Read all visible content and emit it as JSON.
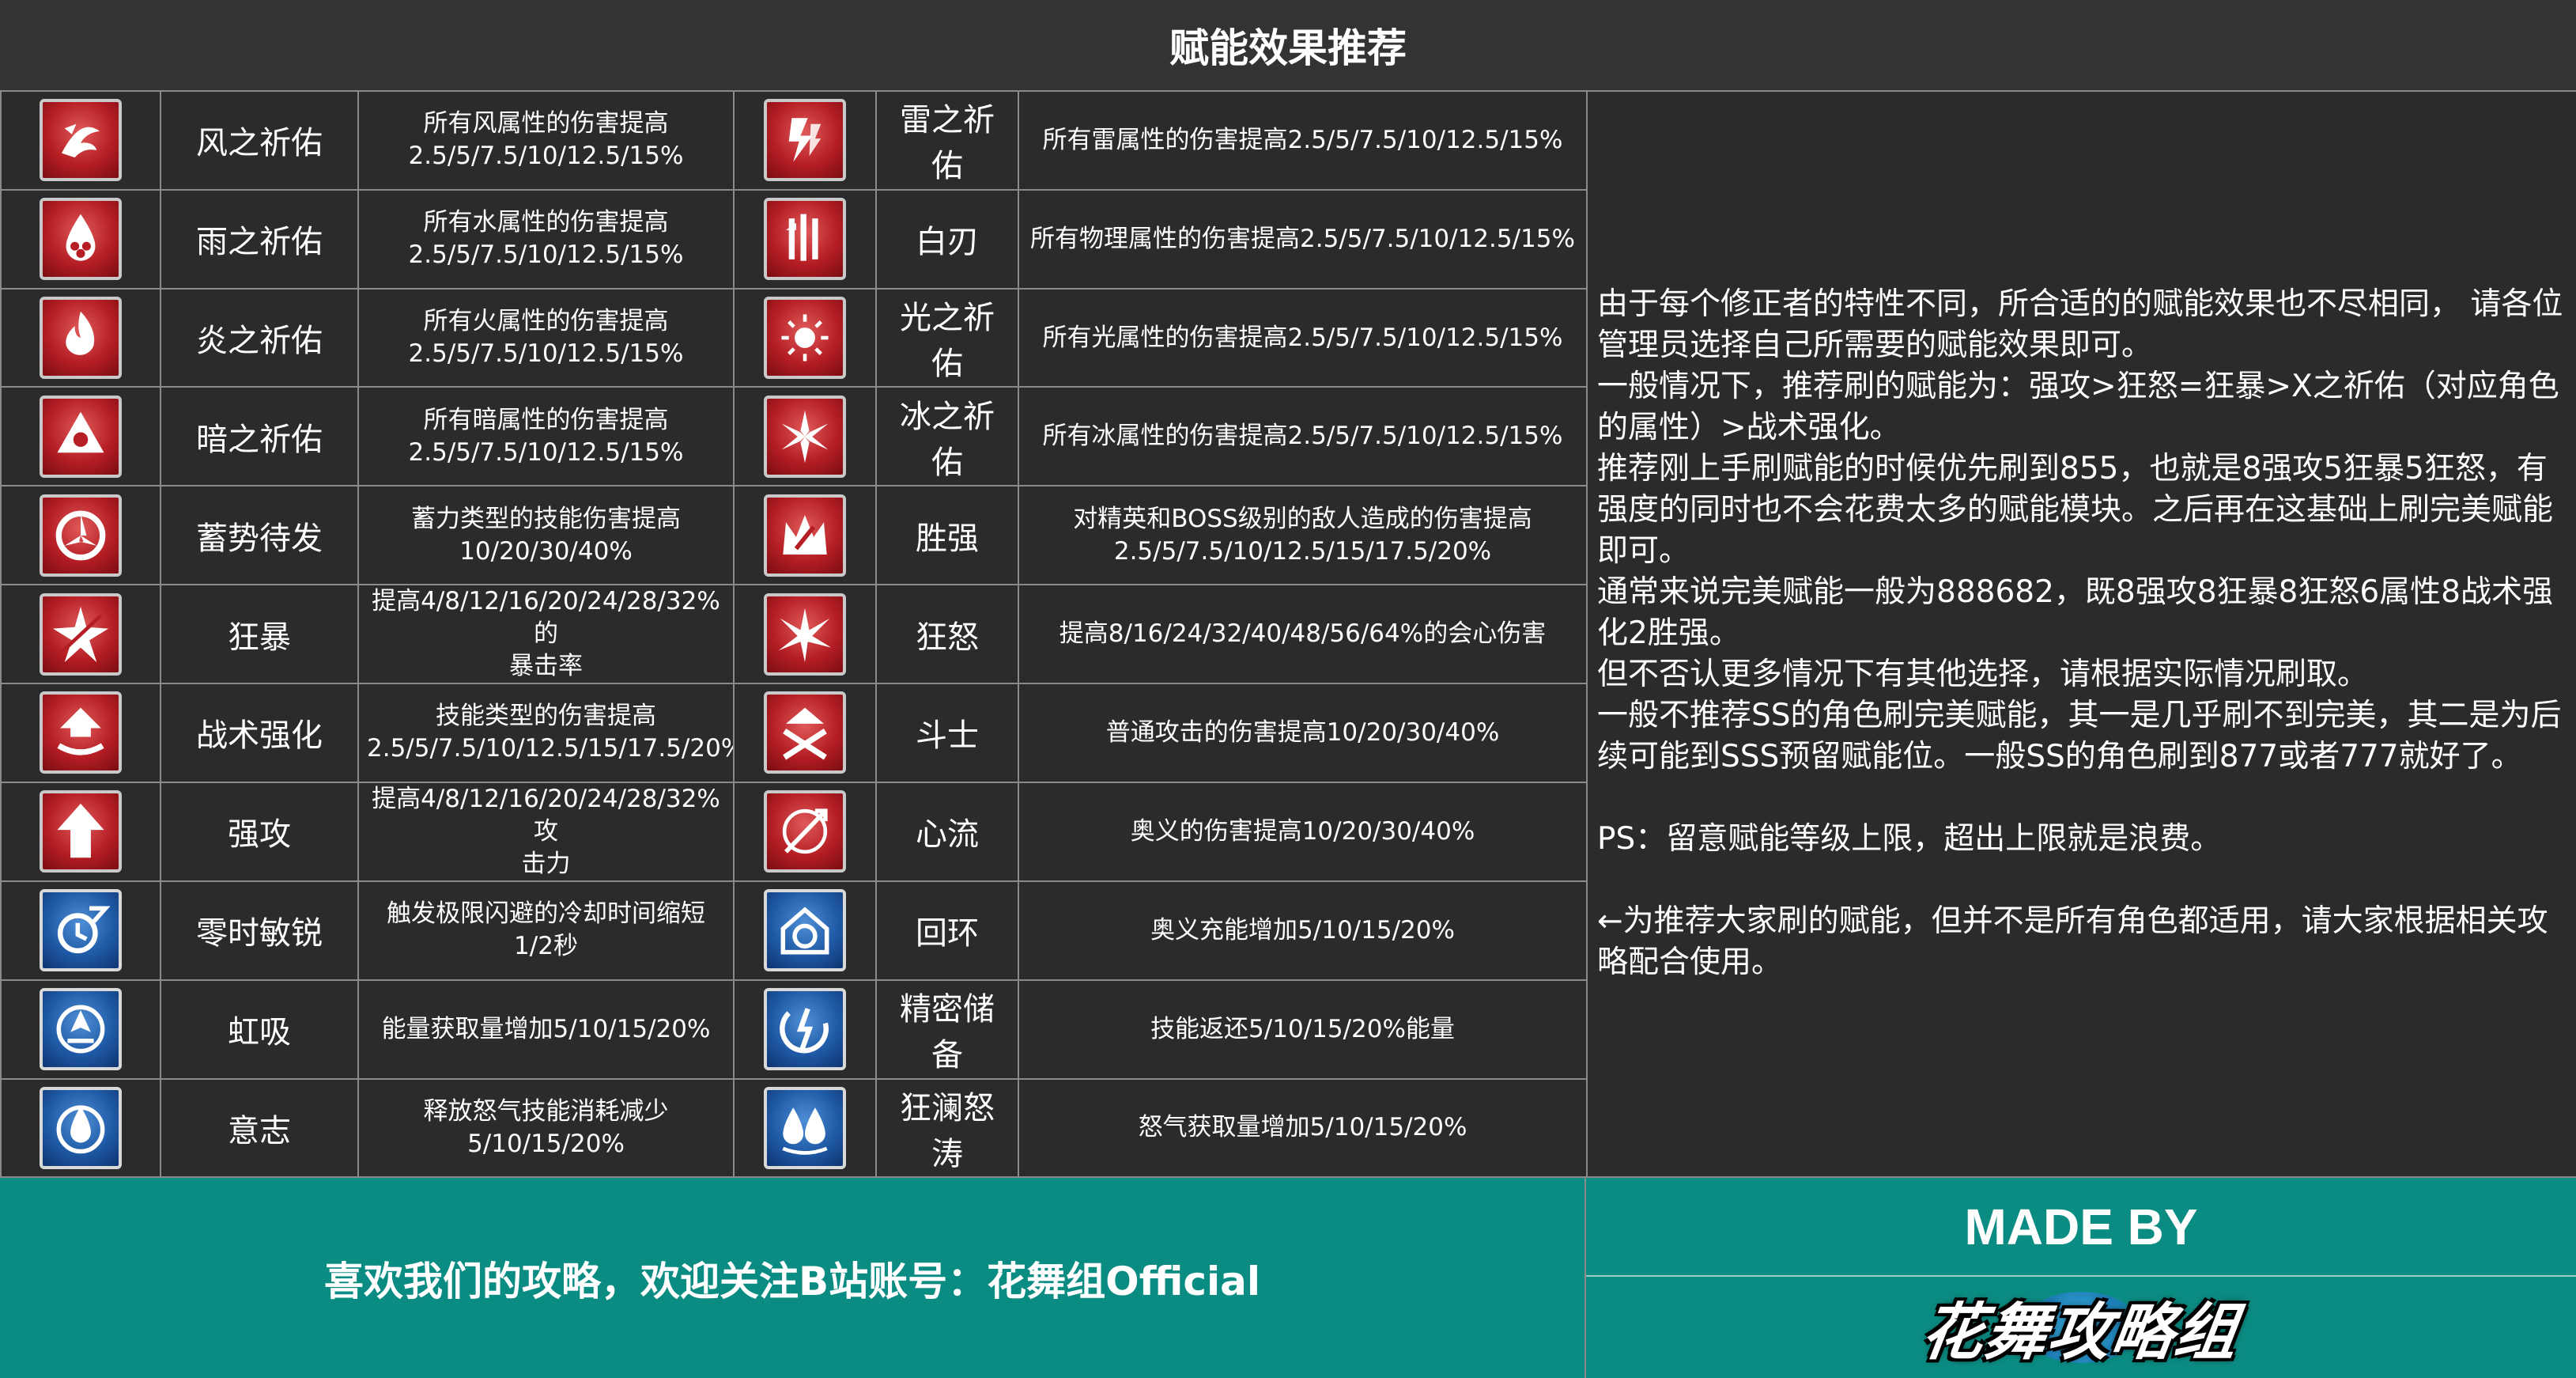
{
  "header": {
    "title": "赋能效果推荐"
  },
  "table": {
    "rows": [
      {
        "left": {
          "icon": "wind-blessing-icon",
          "icon_color": "red",
          "name": "风之祈佑",
          "desc_lines": [
            "所有风属性的伤害提高",
            "2.5/5/7.5/10/12.5/15%"
          ]
        },
        "right": {
          "icon": "thunder-blessing-icon",
          "icon_color": "red",
          "name": "雷之祈佑",
          "desc_lines": [
            "所有雷属性的伤害提高2.5/5/7.5/10/12.5/15%"
          ]
        }
      },
      {
        "left": {
          "icon": "rain-blessing-icon",
          "icon_color": "red",
          "name": "雨之祈佑",
          "desc_lines": [
            "所有水属性的伤害提高",
            "2.5/5/7.5/10/12.5/15%"
          ]
        },
        "right": {
          "icon": "white-blade-icon",
          "icon_color": "red",
          "name": "白刃",
          "desc_lines": [
            "所有物理属性的伤害提高2.5/5/7.5/10/12.5/15%"
          ]
        }
      },
      {
        "left": {
          "icon": "flame-blessing-icon",
          "icon_color": "red",
          "name": "炎之祈佑",
          "desc_lines": [
            "所有火属性的伤害提高",
            "2.5/5/7.5/10/12.5/15%"
          ]
        },
        "right": {
          "icon": "light-blessing-icon",
          "icon_color": "red",
          "name": "光之祈佑",
          "desc_lines": [
            "所有光属性的伤害提高2.5/5/7.5/10/12.5/15%"
          ]
        }
      },
      {
        "left": {
          "icon": "dark-blessing-icon",
          "icon_color": "red",
          "name": "暗之祈佑",
          "desc_lines": [
            "所有暗属性的伤害提高",
            "2.5/5/7.5/10/12.5/15%"
          ]
        },
        "right": {
          "icon": "ice-blessing-icon",
          "icon_color": "red",
          "name": "冰之祈佑",
          "desc_lines": [
            "所有冰属性的伤害提高2.5/5/7.5/10/12.5/15%"
          ]
        }
      },
      {
        "left": {
          "icon": "charge-ready-icon",
          "icon_color": "red",
          "name": "蓄势待发",
          "desc_lines": [
            "蓄力类型的技能伤害提高",
            "10/20/30/40%"
          ]
        },
        "right": {
          "icon": "victor-crown-icon",
          "icon_color": "red",
          "name": "胜强",
          "desc_lines": [
            "对精英和BOSS级别的敌人造成的伤害提高",
            "2.5/5/7.5/10/12.5/15/17.5/20%"
          ]
        }
      },
      {
        "left": {
          "icon": "frenzy-star-icon",
          "icon_color": "red",
          "name": "狂暴",
          "desc_lines": [
            "提高4/8/12/16/20/24/28/32%的",
            "暴击率"
          ]
        },
        "right": {
          "icon": "fury-burst-icon",
          "icon_color": "red",
          "name": "狂怒",
          "desc_lines": [
            "提高8/16/24/32/40/48/56/64%的会心伤害"
          ]
        }
      },
      {
        "left": {
          "icon": "tactical-boost-icon",
          "icon_color": "red",
          "name": "战术强化",
          "desc_lines": [
            "技能类型的伤害提高",
            "2.5/5/7.5/10/12.5/15/17.5/20%"
          ]
        },
        "right": {
          "icon": "fighter-crossed-icon",
          "icon_color": "red",
          "name": "斗士",
          "desc_lines": [
            "普通攻击的伤害提高10/20/30/40%"
          ]
        }
      },
      {
        "left": {
          "icon": "strong-attack-arrow-icon",
          "icon_color": "red",
          "name": "强攻",
          "desc_lines": [
            "提高4/8/12/16/20/24/28/32%攻",
            "击力"
          ]
        },
        "right": {
          "icon": "heart-flow-icon",
          "icon_color": "red",
          "name": "心流",
          "desc_lines": [
            "奥义的伤害提高10/20/30/40%"
          ]
        }
      },
      {
        "left": {
          "icon": "zero-time-dash-icon",
          "icon_color": "blue",
          "name": "零时敏锐",
          "desc_lines": [
            "触发极限闪避的冷却时间缩短",
            "1/2秒"
          ]
        },
        "right": {
          "icon": "cycle-ring-icon",
          "icon_color": "blue",
          "name": "回环",
          "desc_lines": [
            "奥义充能增加5/10/15/20%"
          ]
        }
      },
      {
        "left": {
          "icon": "rainbow-absorb-icon",
          "icon_color": "blue",
          "name": "虹吸",
          "desc_lines": [
            "能量获取量增加5/10/15/20%"
          ]
        },
        "right": {
          "icon": "precision-reserve-icon",
          "icon_color": "blue",
          "name": "精密储备",
          "desc_lines": [
            "技能返还5/10/15/20%能量"
          ]
        }
      },
      {
        "left": {
          "icon": "will-drop-icon",
          "icon_color": "blue",
          "name": "意志",
          "desc_lines": [
            "释放怒气技能消耗减少",
            "5/10/15/20%"
          ]
        },
        "right": {
          "icon": "raging-wave-icon",
          "icon_color": "blue",
          "name": "狂澜怒涛",
          "desc_lines": [
            "怒气获取量增加5/10/15/20%"
          ]
        }
      }
    ]
  },
  "notes": {
    "paragraphs": [
      "由于每个修正者的特性不同，所合适的的赋能效果也不尽相同， 请各位管理员选择自己所需要的赋能效果即可。",
      "一般情况下，推荐刷的赋能为：强攻>狂怒=狂暴>X之祈佑（对应角色的属性）>战术强化。",
      "推荐刚上手刷赋能的时候优先刷到855，也就是8强攻5狂暴5狂怒，有强度的同时也不会花费太多的赋能模块。之后再在这基础上刷完美赋能即可。",
      "通常来说完美赋能一般为888682，既8强攻8狂暴8狂怒6属性8战术强化2胜强。",
      "但不否认更多情况下有其他选择，请根据实际情况刷取。",
      "一般不推荐SS的角色刷完美赋能，其一是几乎刷不到完美，其二是为后续可能到SSS预留赋能位。一般SS的角色刷到877或者777就好了。",
      " ",
      "PS：留意赋能等级上限，超出上限就是浪费。",
      " ",
      "←为推荐大家刷的赋能，但并不是所有角色都适用，请大家根据相关攻略配合使用。"
    ]
  },
  "footer": {
    "follow_text": "喜欢我们的攻略，欢迎关注B站账号：花舞组Official",
    "made_by": "MADE BY",
    "logo_text": "花舞攻略组"
  },
  "colors": {
    "background": "#2b2b2b",
    "grid_line": "#8a8a8a",
    "footer_teal": "#0b8c83",
    "icon_red": "#b51e24",
    "icon_blue": "#1f5aa6"
  }
}
